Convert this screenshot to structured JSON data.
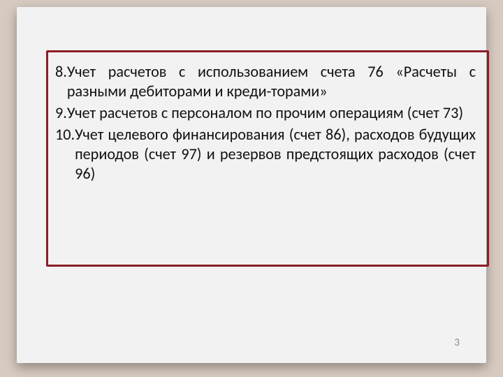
{
  "items": [
    {
      "number": "8.",
      "text": "Учет расчетов с использованием счета 76 «Расчеты с разными дебиторами и креди-торами»"
    },
    {
      "number": "9.",
      "text": "Учет расчетов с персоналом по прочим операциям (счет 73)"
    },
    {
      "number": "10.",
      "text": "Учет целевого финансирования (счет 86), расходов будущих периодов (счет 97) и резервов предстоящих расходов (счет 96)"
    }
  ],
  "page_number": "3"
}
